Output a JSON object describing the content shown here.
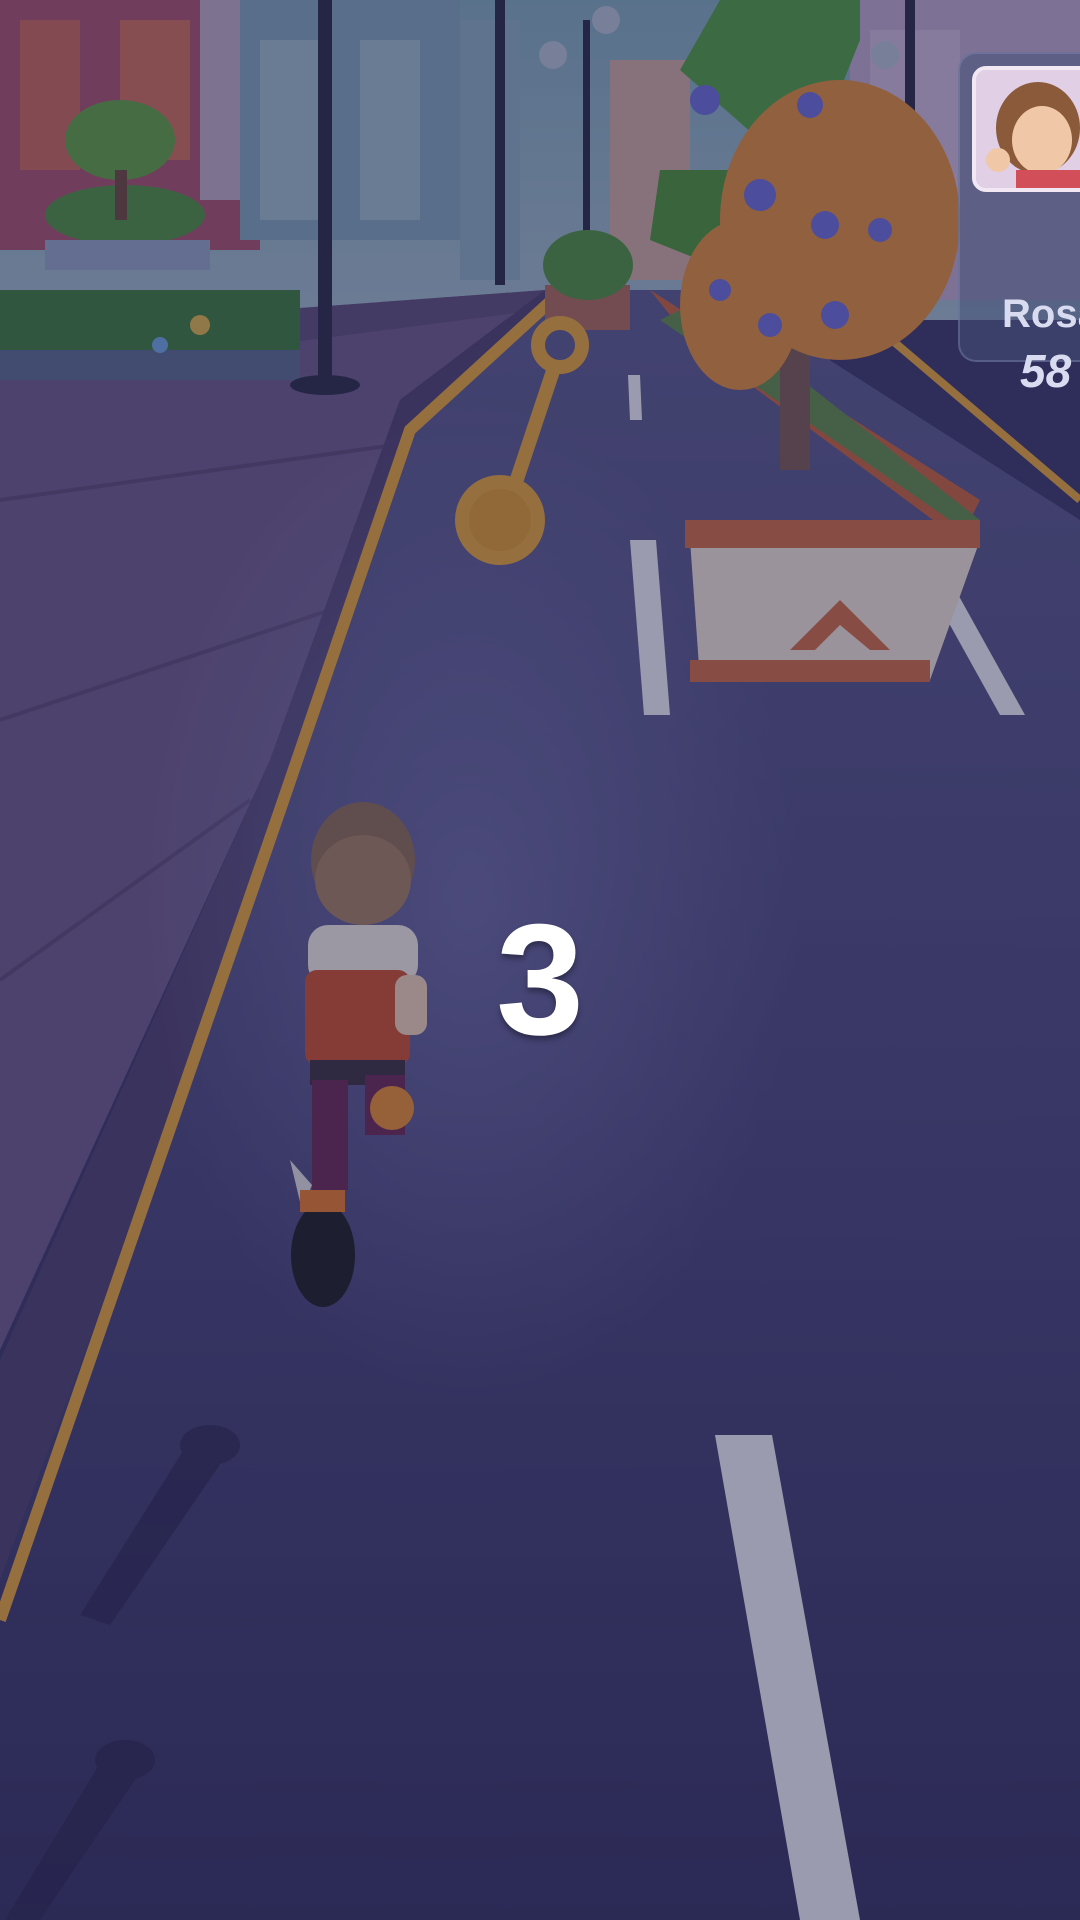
{
  "countdown": "3",
  "opponent": {
    "name": "Rosa",
    "score": "58",
    "avatar_icon": "girl-avatar-icon"
  },
  "colors": {
    "road": "#4a4778",
    "lane_stripe": "#ffffff",
    "curb_line": "#e0a23a",
    "sidewalk": "#6b5a86",
    "overlay": "#1e1c46"
  },
  "icons": [
    "key-pickup-icon",
    "runner-character-icon",
    "tree-planter-icon",
    "lamp-post-icon",
    "hedge-planter-icon"
  ]
}
